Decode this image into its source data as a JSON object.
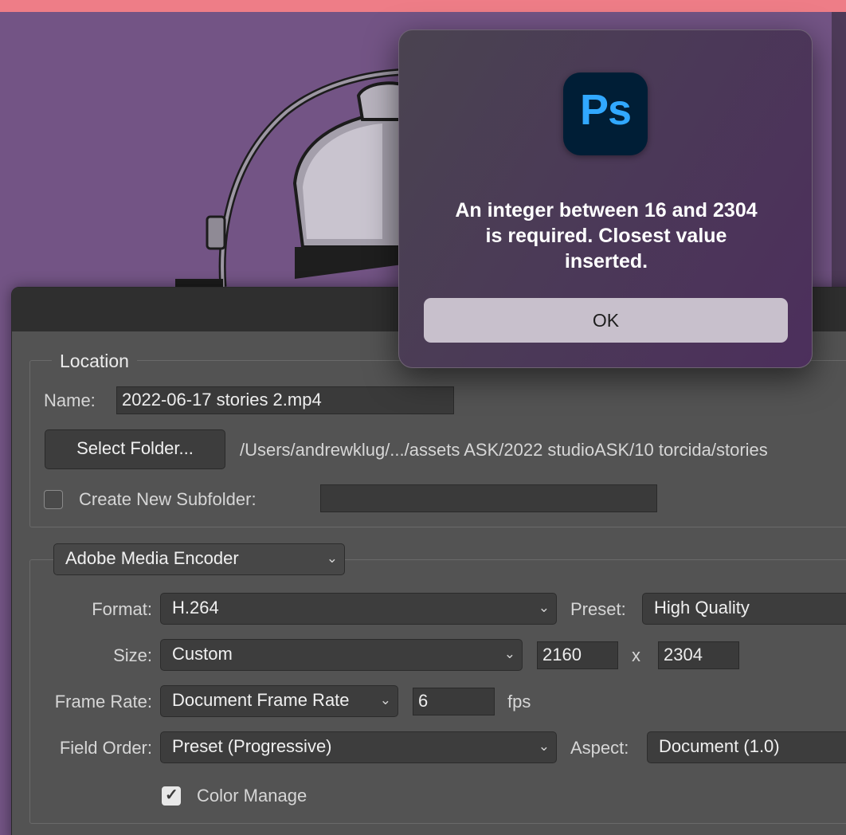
{
  "alert": {
    "icon": "photoshop-app-icon",
    "icon_text": "Ps",
    "message_line1": "An integer between 16 and 2304",
    "message_line2": "is required.  Closest value",
    "message_line3": "inserted.",
    "ok_label": "OK"
  },
  "location": {
    "legend": "Location",
    "name_label": "Name:",
    "name_value": "2022-06-17 stories 2.mp4",
    "select_folder_label": "Select Folder...",
    "folder_path": "/Users/andrewklug/.../assets ASK/2022 studioASK/10 torcida/stories",
    "subfolder_label": "Create New Subfolder:",
    "subfolder_checked": false,
    "subfolder_value": ""
  },
  "encoder": {
    "renderer": "Adobe Media Encoder",
    "format_label": "Format:",
    "format_value": "H.264",
    "preset_label": "Preset:",
    "preset_value": "High Quality",
    "size_label": "Size:",
    "size_value": "Custom",
    "width_value": "2160",
    "x_sep": "x",
    "height_value": "2304",
    "frame_rate_label": "Frame Rate:",
    "frame_rate_value": "Document Frame Rate",
    "fps_value": "6",
    "fps_unit": "fps",
    "field_order_label": "Field Order:",
    "field_order_value": "Preset (Progressive)",
    "aspect_label": "Aspect:",
    "aspect_value": "Document (1.0)",
    "color_manage_label": "Color Manage",
    "color_manage_checked": true
  },
  "colors": {
    "canvas": "#735485",
    "alert_bg": "#4b3a57",
    "dialog_bg": "#535353",
    "ps_blue": "#31a8ff"
  }
}
